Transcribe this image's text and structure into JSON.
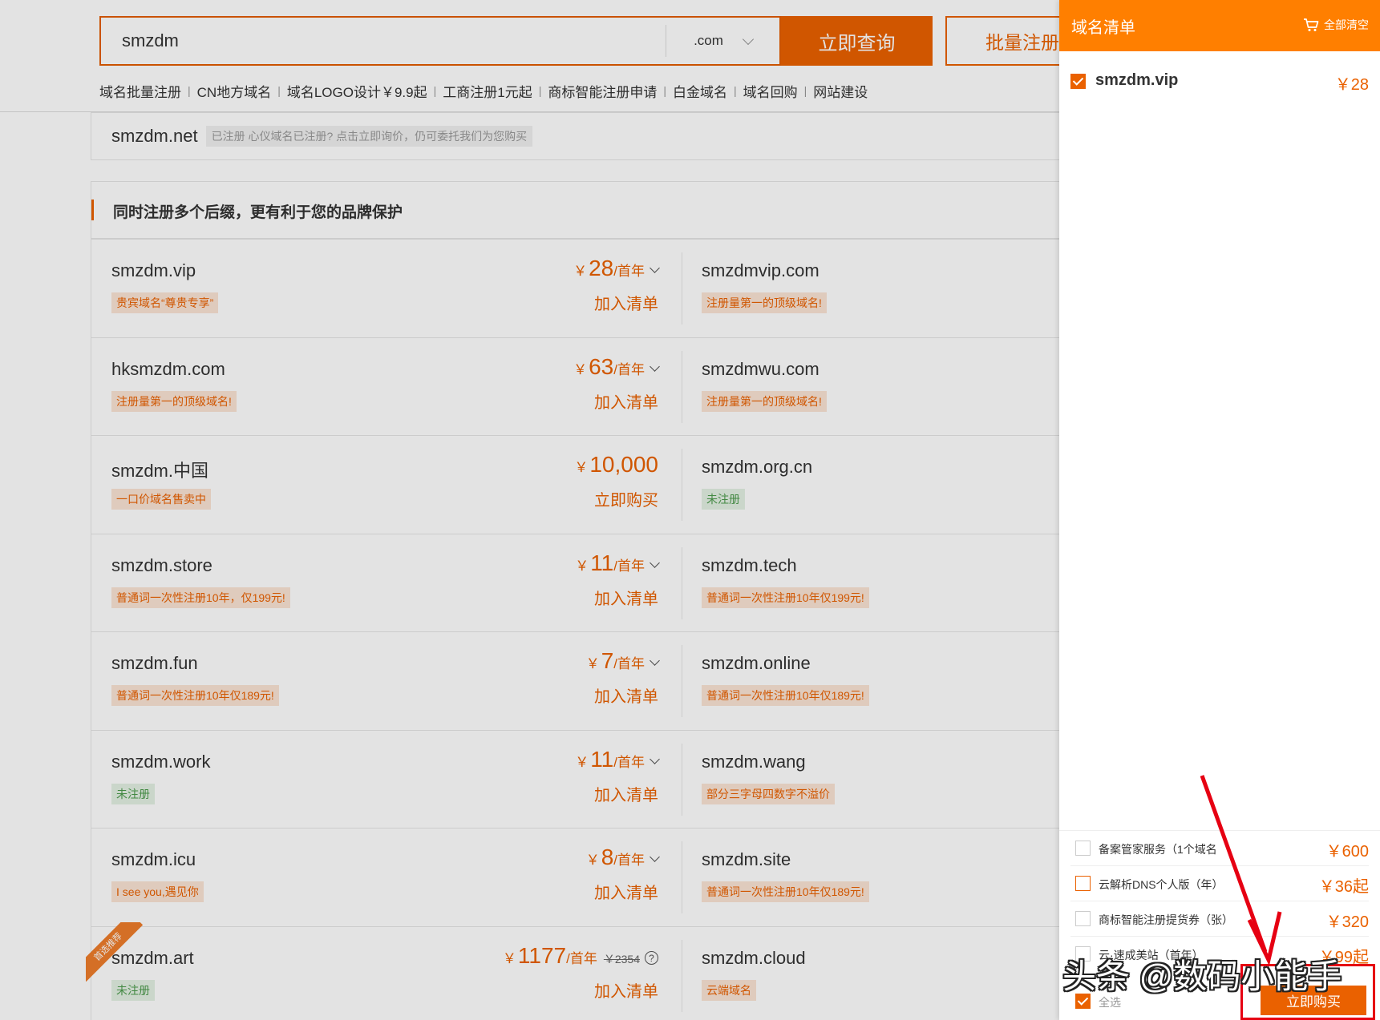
{
  "search": {
    "value": "smzdm",
    "suffix": ".com",
    "query_label": "立即查询",
    "batch_label": "批量注册"
  },
  "quick_links": [
    "域名批量注册",
    "CN地方域名",
    "域名LOGO设计￥9.9起",
    "工商注册1元起",
    "商标智能注册申请",
    "白金域名",
    "域名回购",
    "网站建设"
  ],
  "registered": {
    "domain": "smzdm.net",
    "note": "已注册 心仪域名已注册? 点击立即询价，仍可委托我们为您购买"
  },
  "section_title": "同时注册多个后缀，更有利于您的品牌保护",
  "rows": [
    {
      "left": {
        "domain": "smzdm.vip",
        "tag": "贵宾域名“尊贵专享”",
        "tag_color": "orange",
        "currency": "￥",
        "price": "28",
        "unit": "/首年",
        "action": "加入清单"
      },
      "right": {
        "domain": "smzdmvip.com",
        "tag": "注册量第一的顶级域名!",
        "tag_color": "orange"
      }
    },
    {
      "left": {
        "domain": "hksmzdm.com",
        "tag": "注册量第一的顶级域名!",
        "tag_color": "orange",
        "currency": "￥",
        "price": "63",
        "unit": "/首年",
        "action": "加入清单"
      },
      "right": {
        "domain": "smzdmwu.com",
        "tag": "注册量第一的顶级域名!",
        "tag_color": "orange"
      }
    },
    {
      "left": {
        "domain": "smzdm.中国",
        "tag": "一口价域名售卖中",
        "tag_color": "orange",
        "currency": "￥",
        "price": "10,000",
        "unit": "",
        "action": "立即购买"
      },
      "right": {
        "domain": "smzdm.org.cn",
        "tag": "未注册",
        "tag_color": "green"
      }
    },
    {
      "left": {
        "domain": "smzdm.store",
        "tag": "普通词一次性注册10年，仅199元!",
        "tag_color": "orange",
        "currency": "￥",
        "price": "11",
        "unit": "/首年",
        "action": "加入清单"
      },
      "right": {
        "domain": "smzdm.tech",
        "tag": "普通词一次性注册10年仅199元!",
        "tag_color": "orange"
      }
    },
    {
      "left": {
        "domain": "smzdm.fun",
        "tag": "普通词一次性注册10年仅189元!",
        "tag_color": "orange",
        "currency": "￥",
        "price": "7",
        "unit": "/首年",
        "action": "加入清单"
      },
      "right": {
        "domain": "smzdm.online",
        "tag": "普通词一次性注册10年仅189元!",
        "tag_color": "orange"
      }
    },
    {
      "left": {
        "domain": "smzdm.work",
        "tag": "未注册",
        "tag_color": "green",
        "currency": "￥",
        "price": "11",
        "unit": "/首年",
        "action": "加入清单"
      },
      "right": {
        "domain": "smzdm.wang",
        "tag": "部分三字母四数字不溢价",
        "tag_color": "orange"
      }
    },
    {
      "left": {
        "domain": "smzdm.icu",
        "tag": "I see you,遇见你",
        "tag_color": "orange",
        "currency": "￥",
        "price": "8",
        "unit": "/首年",
        "action": "加入清单"
      },
      "right": {
        "domain": "smzdm.site",
        "tag": "普通词一次性注册10年仅189元!",
        "tag_color": "orange"
      }
    },
    {
      "left": {
        "domain": "smzdm.art",
        "tag": "未注册",
        "tag_color": "green",
        "currency": "￥",
        "price": "1177",
        "unit": "/首年",
        "orig": "￥2354",
        "action": "加入清单",
        "ribbon": "首选推荐"
      },
      "right": {
        "domain": "smzdm.cloud",
        "tag": "云端域名",
        "tag_color": "orange"
      }
    }
  ],
  "panel": {
    "title": "域名清单",
    "clear_label": "全部清空",
    "cart": [
      {
        "domain": "smzdm.vip",
        "price": "￥28",
        "checked": true
      }
    ],
    "services": [
      {
        "label": "备案管家服务（1个域名",
        "price": "￥600"
      },
      {
        "label": "云解析DNS个人版（年）",
        "price": "￥36起"
      },
      {
        "label": "商标智能注册提货券（张）",
        "price": "￥320"
      },
      {
        "label": "云·速成美站（首年）",
        "price": "￥99起"
      }
    ],
    "select_all": "全选",
    "buy_label": "立即购买"
  },
  "watermark": "头条 @数码小能手",
  "colors": {
    "accent": "#ea6100",
    "header": "#ff7f00",
    "highlight": "#e60012",
    "green_tag": "#4c9a4c"
  }
}
